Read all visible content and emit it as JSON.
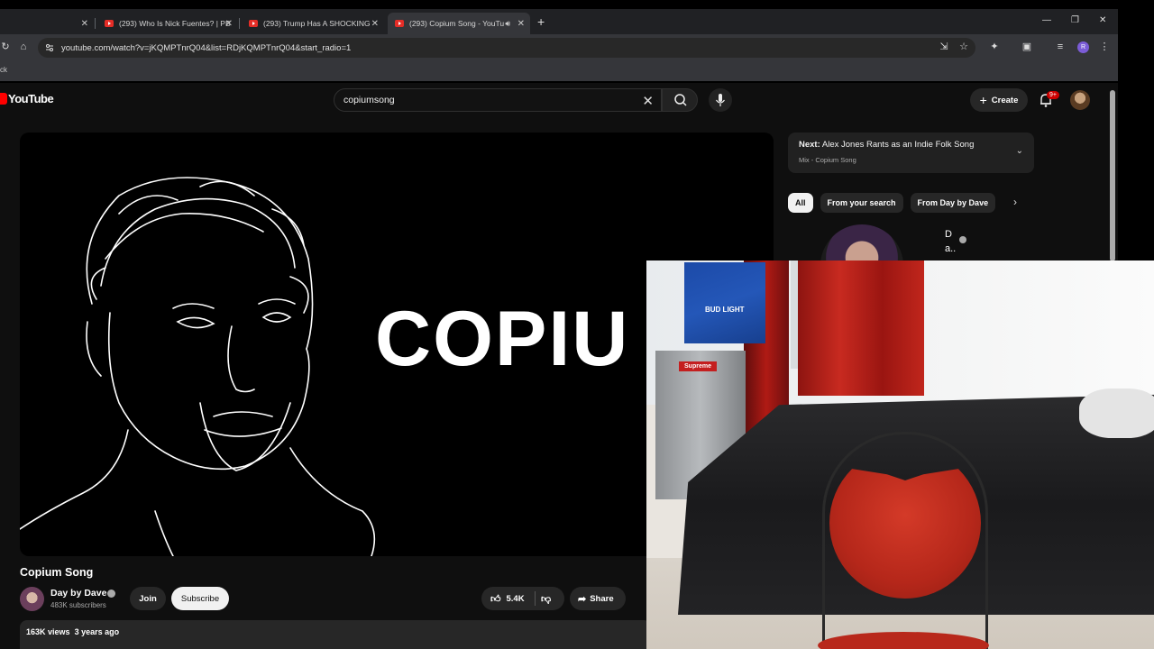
{
  "browser": {
    "tabs": [
      {
        "label": "",
        "active": false
      },
      {
        "label": "(293) Who Is Nick Fuentes? | PB",
        "active": false
      },
      {
        "label": "(293) Trump Has A SHOCKING",
        "active": false
      },
      {
        "label": "(293) Copium Song - YouTu",
        "active": true
      }
    ],
    "url": "youtube.com/watch?v=jKQMPTnrQ04&list=RDjKQMPTnrQ04&start_radio=1",
    "bookmark_fragment": "ck",
    "profile_initial": "R"
  },
  "youtube": {
    "logo_text": "YouTube",
    "search_value": "copiumsong",
    "create_label": "Create",
    "notif_count": "9+",
    "video": {
      "player_text": "COPIU",
      "title": "Copium Song",
      "channel": "Day by Dave",
      "subscribers": "483K subscribers",
      "join_label": "Join",
      "subscribe_label": "Subscribe",
      "likes": "5.4K",
      "share_label": "Share",
      "views": "163K views",
      "age": "3 years ago"
    },
    "next": {
      "prefix": "Next:",
      "title": "Alex Jones Rants as an Indie Folk Song",
      "subtitle": "Mix - Copium Song"
    },
    "chips": [
      "All",
      "From your search",
      "From Day by Dave"
    ],
    "reco_name_l1": "D",
    "reco_name_l2": "a.."
  },
  "webcam": {
    "box_label": "BUD LIGHT",
    "fridge_sticker": "Supreme"
  }
}
